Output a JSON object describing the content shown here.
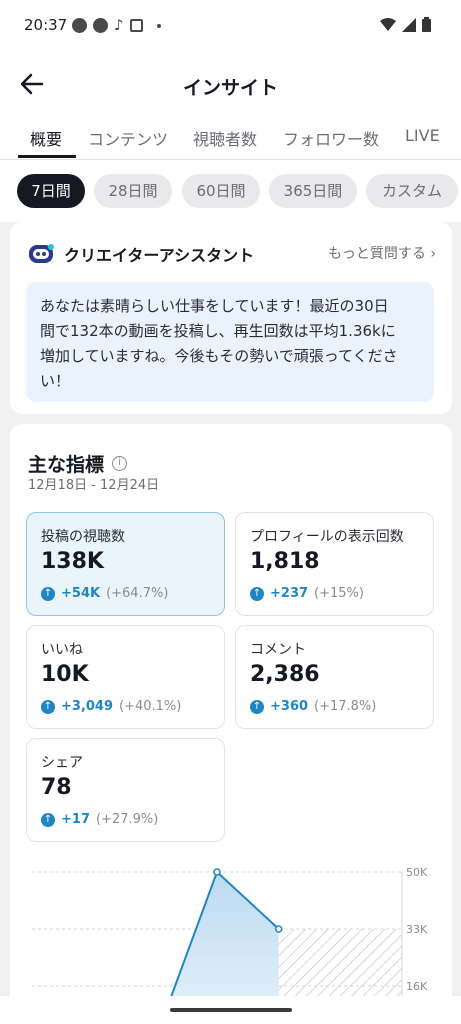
{
  "status_bar": {
    "time": "20:37"
  },
  "header": {
    "title": "インサイト"
  },
  "tabs": [
    "概要",
    "コンテンツ",
    "視聴者数",
    "フォロワー数",
    "LIVE"
  ],
  "periods": [
    "7日間",
    "28日間",
    "60日間",
    "365日間",
    "カスタム"
  ],
  "assistant": {
    "title": "クリエイターアシスタント",
    "more_label": "もっと質問する",
    "message_lines": [
      "あなたは素晴らしい仕事をしています！最近の30日",
      "間で132本の動画を投稿し、再生回数は平均1.36kに",
      "増加していますね。今後もその勢いで頑張ってくださ",
      "い！"
    ]
  },
  "key_metrics": {
    "title": "主な指標",
    "date_range": "12月18日 - 12月24日",
    "items": [
      {
        "label": "投稿の視聴数",
        "value": "138K",
        "delta": "+54K",
        "pct": "(+64.7%)"
      },
      {
        "label": "プロフィールの表示回数",
        "value": "1,818",
        "delta": "+237",
        "pct": "(+15%)"
      },
      {
        "label": "いいね",
        "value": "10K",
        "delta": "+3,049",
        "pct": "(+40.1%)"
      },
      {
        "label": "コメント",
        "value": "2,386",
        "delta": "+360",
        "pct": "(+17.8%)"
      },
      {
        "label": "シェア",
        "value": "78",
        "delta": "+17",
        "pct": "(+27.9%)"
      }
    ]
  },
  "chart_data": {
    "type": "area",
    "y_tick_labels": [
      "50K",
      "33K",
      "16K"
    ],
    "ylim": [
      0,
      50000
    ],
    "x": [
      1,
      2,
      3,
      4,
      5,
      6,
      7
    ],
    "values": [
      null,
      2000,
      0,
      50000,
      33000,
      null,
      null
    ],
    "accent_color": "#1f86c6",
    "grid": true
  },
  "colors": {
    "accent": "#1f86c6",
    "selected_bg": "#eaf4fb",
    "assistant_bg": "#eaf3fd"
  }
}
